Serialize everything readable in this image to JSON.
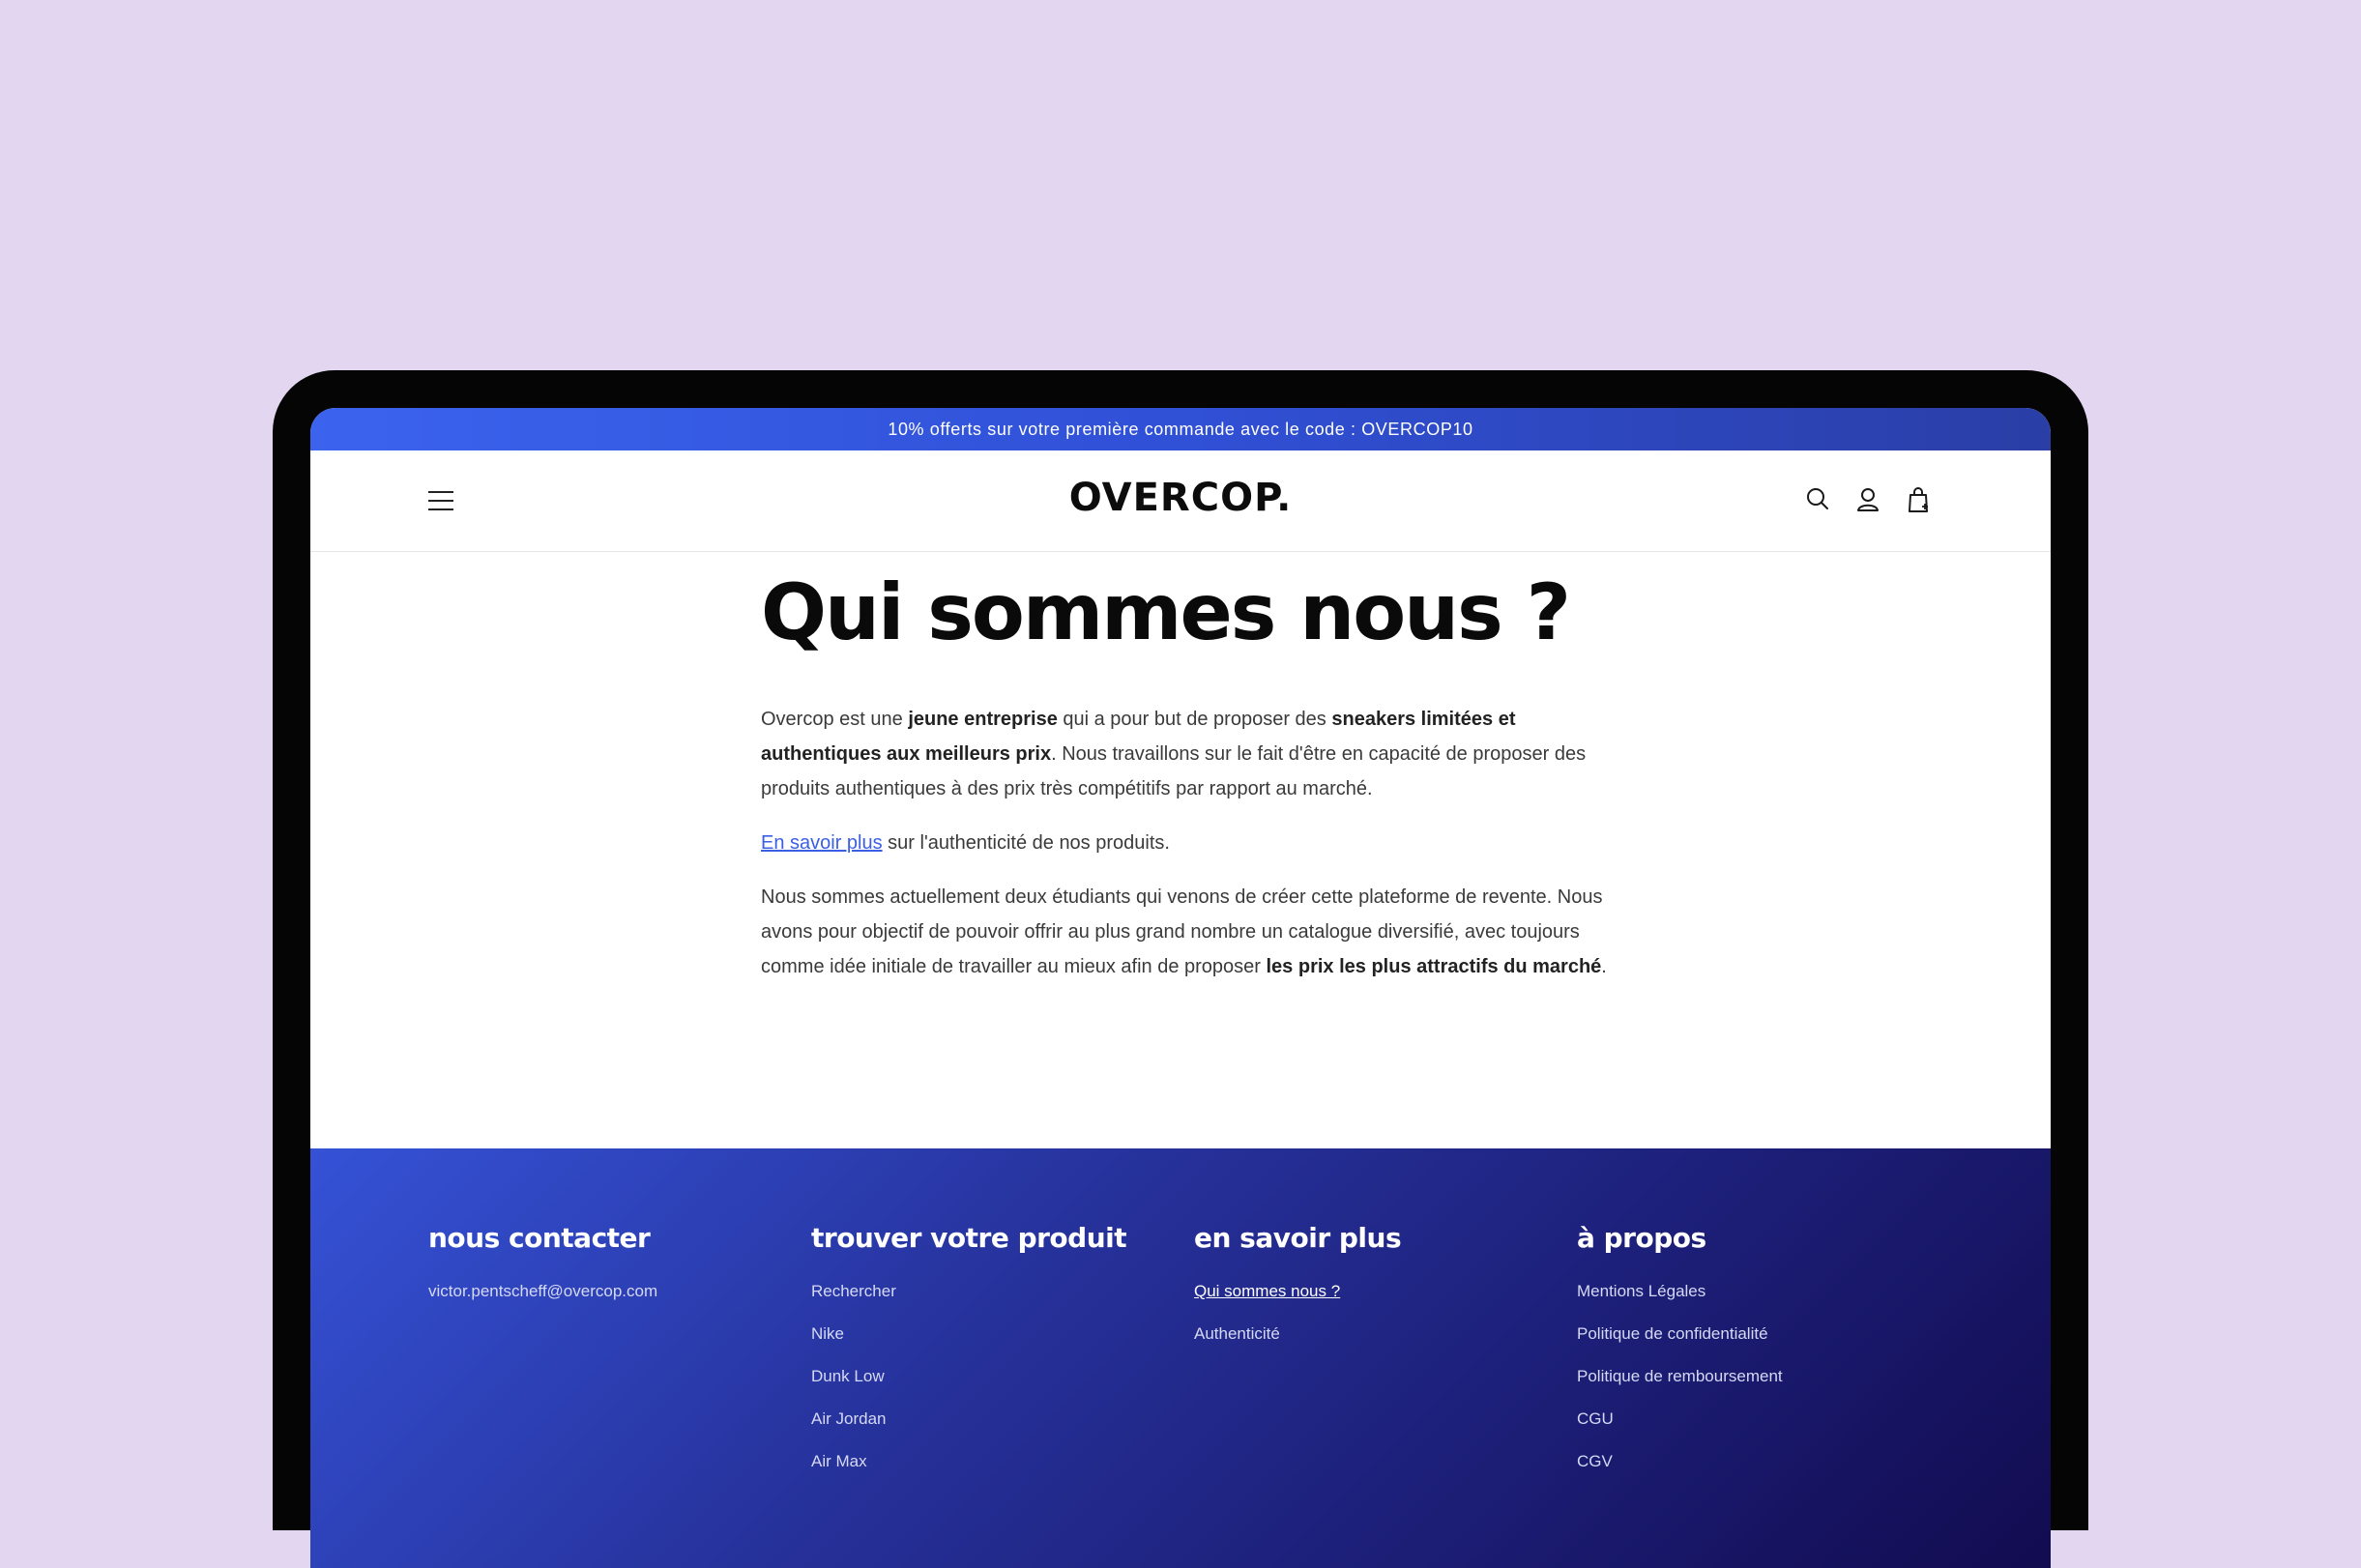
{
  "announcement": "10% offerts sur votre première commande avec le code : OVERCOP10",
  "header": {
    "logo": "OVERCOP.",
    "icons": [
      "menu-icon",
      "search-icon",
      "account-icon",
      "cart-icon"
    ]
  },
  "main": {
    "title": "Qui sommes nous ?",
    "p1": {
      "t1": "Overcop est une ",
      "b1": "jeune entreprise",
      "t2": " qui a pour but de proposer des ",
      "b2": "sneakers limitées et authentiques aux meilleurs prix",
      "t3": ". Nous travaillons sur le fait d'être en capacité de proposer des produits authentiques à des prix très compétitifs par rapport au marché."
    },
    "p2": {
      "link": "En savoir plus",
      "t1": " sur l'authenticité de nos produits."
    },
    "p3": {
      "t1": "Nous sommes actuellement deux étudiants qui venons de créer cette plateforme de revente. Nous avons pour objectif de pouvoir offrir au plus grand nombre un catalogue diversifié, avec toujours comme idée initiale de travailler au mieux afin de proposer ",
      "b1": "les prix les plus attractifs du marché",
      "t2": "."
    }
  },
  "footer": {
    "contact": {
      "title": "nous contacter",
      "email": "victor.pentscheff@overcop.com"
    },
    "products": {
      "title": "trouver votre produit",
      "links": [
        "Rechercher",
        "Nike",
        "Dunk Low",
        "Air Jordan",
        "Air Max"
      ]
    },
    "learn": {
      "title": "en savoir plus",
      "links": [
        "Qui sommes nous ?",
        "Authenticité"
      ]
    },
    "about": {
      "title": "à propos",
      "links": [
        "Mentions Légales",
        "Politique de confidentialité",
        "Politique de remboursement",
        "CGU",
        "CGV"
      ]
    }
  },
  "colors": {
    "background": "#e2d6f1",
    "accent": "#3b63ee",
    "footer_dark": "#120c50",
    "link": "#3a5ee4"
  }
}
